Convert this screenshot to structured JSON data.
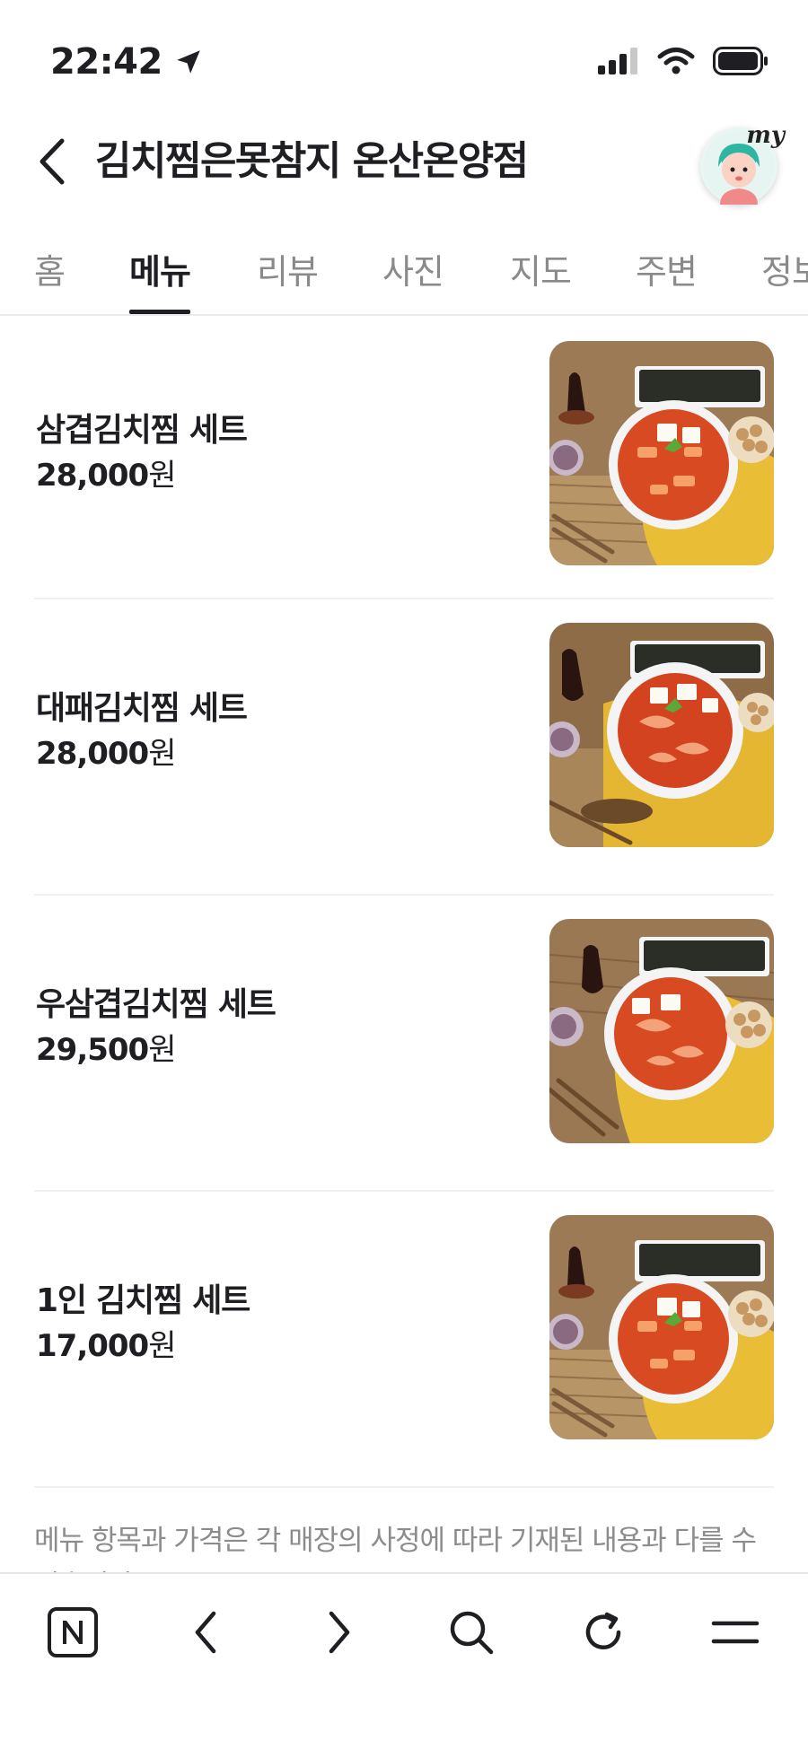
{
  "status": {
    "time": "22:42"
  },
  "header": {
    "title": "김치찜은못참지 온산온양점",
    "avatar_label": "my"
  },
  "tabs": [
    {
      "label": "홈",
      "active": false
    },
    {
      "label": "메뉴",
      "active": true
    },
    {
      "label": "리뷰",
      "active": false
    },
    {
      "label": "사진",
      "active": false
    },
    {
      "label": "지도",
      "active": false
    },
    {
      "label": "주변",
      "active": false
    },
    {
      "label": "정보",
      "active": false
    }
  ],
  "menu": [
    {
      "name": "삼겹김치찜 세트",
      "price": "28,000",
      "unit": "원"
    },
    {
      "name": "대패김치찜 세트",
      "price": "28,000",
      "unit": "원"
    },
    {
      "name": "우삼겹김치찜 세트",
      "price": "29,500",
      "unit": "원"
    },
    {
      "name": "1인 김치찜 세트",
      "price": "17,000",
      "unit": "원"
    }
  ],
  "notice": "메뉴 항목과 가격은 각 매장의 사정에 따라 기재된 내용과 다를 수 있습니다.",
  "bottom_bar": {
    "icons": [
      "naver-home-icon",
      "back-arrow-icon",
      "forward-arrow-icon",
      "search-icon",
      "refresh-icon",
      "menu-icon"
    ]
  },
  "colors": {
    "text": "#1e1e23",
    "muted": "#8a8a8a",
    "divider": "#ebebeb"
  }
}
